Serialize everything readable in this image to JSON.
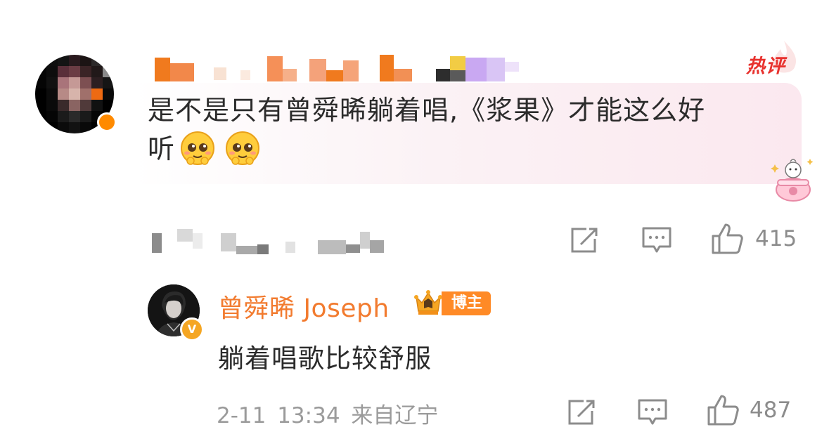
{
  "comment": {
    "hot_badge": "热评",
    "text_line1": "是不是只有曾舜晞躺着唱,《浆果》才能这么好",
    "text_line2": "听"
  },
  "actions": {
    "likes": "415"
  },
  "reply": {
    "author": "曾舜晞 Joseph",
    "badge": "博主",
    "verified_mark": "V",
    "text": "躺着唱歌比较舒服",
    "meta": "2-11 13:34 来自辽宁",
    "likes": "487"
  },
  "colors": {
    "accent_orange": "#f27b2f",
    "hot_red": "#e8322e",
    "bubble_pink": "#fbe8ef",
    "icon_gray": "#8c8c8c"
  },
  "icons": [
    "forward-icon",
    "comment-icon",
    "like-icon",
    "crown-icon",
    "cute-emoji-icon",
    "decoration-sticker-icon"
  ]
}
